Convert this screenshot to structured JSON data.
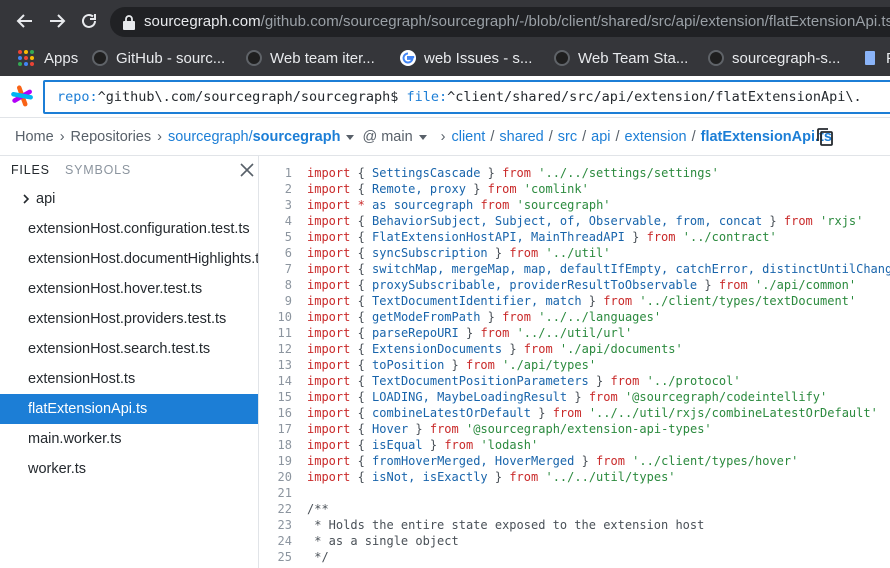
{
  "browser": {
    "url_host": "sourcegraph.com",
    "url_path": "/github.com/sourcegraph/sourcegraph/-/blob/client/shared/src/api/extension/flatExtensionApi.ts",
    "bookmarks": [
      {
        "label": "Apps",
        "icon": "apps-grid-icon"
      },
      {
        "label": "GitHub - sourc...",
        "icon": "github-icon"
      },
      {
        "label": "Web team iter...",
        "icon": "github-icon"
      },
      {
        "label": "web Issues - s...",
        "icon": "google-icon"
      },
      {
        "label": "Web Team Sta...",
        "icon": "github-icon"
      },
      {
        "label": "sourcegraph-s...",
        "icon": "github-icon"
      },
      {
        "label": "P",
        "icon": "doc-icon"
      }
    ]
  },
  "search": {
    "repo_key": "repo:",
    "repo_value": "^github\\.com/sourcegraph/sourcegraph$",
    "file_key": "file:",
    "file_value": "^client/shared/src/api/extension/flatExtensionApi\\."
  },
  "breadcrumb": {
    "home": "Home",
    "repositories": "Repositories",
    "repo_owner": "sourcegraph/",
    "repo_name": "sourcegraph",
    "revision": "@ main",
    "path": [
      "client",
      "shared",
      "src",
      "api",
      "extension"
    ],
    "file": "flatExtensionApi.ts"
  },
  "sidebar": {
    "tabs": [
      "FILES",
      "SYMBOLS"
    ],
    "items": [
      {
        "label": "api",
        "type": "dir"
      },
      {
        "label": "extensionHost.configuration.test.ts",
        "type": "file"
      },
      {
        "label": "extensionHost.documentHighlights.test.ts",
        "type": "file"
      },
      {
        "label": "extensionHost.hover.test.ts",
        "type": "file"
      },
      {
        "label": "extensionHost.providers.test.ts",
        "type": "file"
      },
      {
        "label": "extensionHost.search.test.ts",
        "type": "file"
      },
      {
        "label": "extensionHost.ts",
        "type": "file"
      },
      {
        "label": "flatExtensionApi.ts",
        "type": "file",
        "selected": true
      },
      {
        "label": "main.worker.ts",
        "type": "file"
      },
      {
        "label": "worker.ts",
        "type": "file"
      }
    ]
  },
  "code": {
    "lines": [
      [
        [
          "kw",
          "import"
        ],
        [
          "pun",
          " { "
        ],
        [
          "idt",
          "SettingsCascade"
        ],
        [
          "pun",
          " } "
        ],
        [
          "kw",
          "from"
        ],
        [
          "pun",
          " "
        ],
        [
          "str",
          "'../../settings/settings'"
        ]
      ],
      [
        [
          "kw",
          "import"
        ],
        [
          "pun",
          " { "
        ],
        [
          "idt",
          "Remote, proxy"
        ],
        [
          "pun",
          " } "
        ],
        [
          "kw",
          "from"
        ],
        [
          "pun",
          " "
        ],
        [
          "str",
          "'comlink'"
        ]
      ],
      [
        [
          "kw",
          "import"
        ],
        [
          "pun",
          " "
        ],
        [
          "kw",
          "*"
        ],
        [
          "pun",
          " "
        ],
        [
          "idt",
          "as sourcegraph"
        ],
        [
          "pun",
          " "
        ],
        [
          "kw",
          "from"
        ],
        [
          "pun",
          " "
        ],
        [
          "str",
          "'sourcegraph'"
        ]
      ],
      [
        [
          "kw",
          "import"
        ],
        [
          "pun",
          " { "
        ],
        [
          "idt",
          "BehaviorSubject, Subject, of, Observable, from, concat"
        ],
        [
          "pun",
          " } "
        ],
        [
          "kw",
          "from"
        ],
        [
          "pun",
          " "
        ],
        [
          "str",
          "'rxjs'"
        ]
      ],
      [
        [
          "kw",
          "import"
        ],
        [
          "pun",
          " { "
        ],
        [
          "idt",
          "FlatExtensionHostAPI, MainThreadAPI"
        ],
        [
          "pun",
          " } "
        ],
        [
          "kw",
          "from"
        ],
        [
          "pun",
          " "
        ],
        [
          "str",
          "'../contract'"
        ]
      ],
      [
        [
          "kw",
          "import"
        ],
        [
          "pun",
          " { "
        ],
        [
          "idt",
          "syncSubscription"
        ],
        [
          "pun",
          " } "
        ],
        [
          "kw",
          "from"
        ],
        [
          "pun",
          " "
        ],
        [
          "str",
          "'../util'"
        ]
      ],
      [
        [
          "kw",
          "import"
        ],
        [
          "pun",
          " { "
        ],
        [
          "idt",
          "switchMap, mergeMap, map, defaultIfEmpty, catchError, distinctUntilChanged"
        ],
        [
          "pun",
          " }"
        ]
      ],
      [
        [
          "kw",
          "import"
        ],
        [
          "pun",
          " { "
        ],
        [
          "idt",
          "proxySubscribable, providerResultToObservable"
        ],
        [
          "pun",
          " } "
        ],
        [
          "kw",
          "from"
        ],
        [
          "pun",
          " "
        ],
        [
          "str",
          "'./api/common'"
        ]
      ],
      [
        [
          "kw",
          "import"
        ],
        [
          "pun",
          " { "
        ],
        [
          "idt",
          "TextDocumentIdentifier, match"
        ],
        [
          "pun",
          " } "
        ],
        [
          "kw",
          "from"
        ],
        [
          "pun",
          " "
        ],
        [
          "str",
          "'../client/types/textDocument'"
        ]
      ],
      [
        [
          "kw",
          "import"
        ],
        [
          "pun",
          " { "
        ],
        [
          "idt",
          "getModeFromPath"
        ],
        [
          "pun",
          " } "
        ],
        [
          "kw",
          "from"
        ],
        [
          "pun",
          " "
        ],
        [
          "str",
          "'../../languages'"
        ]
      ],
      [
        [
          "kw",
          "import"
        ],
        [
          "pun",
          " { "
        ],
        [
          "idt",
          "parseRepoURI"
        ],
        [
          "pun",
          " } "
        ],
        [
          "kw",
          "from"
        ],
        [
          "pun",
          " "
        ],
        [
          "str",
          "'../../util/url'"
        ]
      ],
      [
        [
          "kw",
          "import"
        ],
        [
          "pun",
          " { "
        ],
        [
          "idt",
          "ExtensionDocuments"
        ],
        [
          "pun",
          " } "
        ],
        [
          "kw",
          "from"
        ],
        [
          "pun",
          " "
        ],
        [
          "str",
          "'./api/documents'"
        ]
      ],
      [
        [
          "kw",
          "import"
        ],
        [
          "pun",
          " { "
        ],
        [
          "idt",
          "toPosition"
        ],
        [
          "pun",
          " } "
        ],
        [
          "kw",
          "from"
        ],
        [
          "pun",
          " "
        ],
        [
          "str",
          "'./api/types'"
        ]
      ],
      [
        [
          "kw",
          "import"
        ],
        [
          "pun",
          " { "
        ],
        [
          "idt",
          "TextDocumentPositionParameters"
        ],
        [
          "pun",
          " } "
        ],
        [
          "kw",
          "from"
        ],
        [
          "pun",
          " "
        ],
        [
          "str",
          "'../protocol'"
        ]
      ],
      [
        [
          "kw",
          "import"
        ],
        [
          "pun",
          " { "
        ],
        [
          "idt",
          "LOADING, MaybeLoadingResult"
        ],
        [
          "pun",
          " } "
        ],
        [
          "kw",
          "from"
        ],
        [
          "pun",
          " "
        ],
        [
          "str",
          "'@sourcegraph/codeintellify'"
        ]
      ],
      [
        [
          "kw",
          "import"
        ],
        [
          "pun",
          " { "
        ],
        [
          "idt",
          "combineLatestOrDefault"
        ],
        [
          "pun",
          " } "
        ],
        [
          "kw",
          "from"
        ],
        [
          "pun",
          " "
        ],
        [
          "str",
          "'../../util/rxjs/combineLatestOrDefault'"
        ]
      ],
      [
        [
          "kw",
          "import"
        ],
        [
          "pun",
          " { "
        ],
        [
          "idt",
          "Hover"
        ],
        [
          "pun",
          " } "
        ],
        [
          "kw",
          "from"
        ],
        [
          "pun",
          " "
        ],
        [
          "str",
          "'@sourcegraph/extension-api-types'"
        ]
      ],
      [
        [
          "kw",
          "import"
        ],
        [
          "pun",
          " { "
        ],
        [
          "idt",
          "isEqual"
        ],
        [
          "pun",
          " } "
        ],
        [
          "kw",
          "from"
        ],
        [
          "pun",
          " "
        ],
        [
          "str",
          "'lodash'"
        ]
      ],
      [
        [
          "kw",
          "import"
        ],
        [
          "pun",
          " { "
        ],
        [
          "idt",
          "fromHoverMerged, HoverMerged"
        ],
        [
          "pun",
          " } "
        ],
        [
          "kw",
          "from"
        ],
        [
          "pun",
          " "
        ],
        [
          "str",
          "'../client/types/hover'"
        ]
      ],
      [
        [
          "kw",
          "import"
        ],
        [
          "pun",
          " { "
        ],
        [
          "idt",
          "isNot, isExactly"
        ],
        [
          "pun",
          " } "
        ],
        [
          "kw",
          "from"
        ],
        [
          "pun",
          " "
        ],
        [
          "str",
          "'../../util/types'"
        ]
      ],
      [],
      [
        [
          "cmt",
          "/**"
        ]
      ],
      [
        [
          "cmt",
          " * Holds the entire state exposed to the extension host"
        ]
      ],
      [
        [
          "cmt",
          " * as a single object"
        ]
      ],
      [
        [
          "cmt",
          " */"
        ]
      ]
    ]
  },
  "colors": {
    "accent": "#1c7ed6",
    "chrome_bg": "#35363a",
    "keyword": "#c92a2a",
    "string": "#2b8a3e"
  }
}
